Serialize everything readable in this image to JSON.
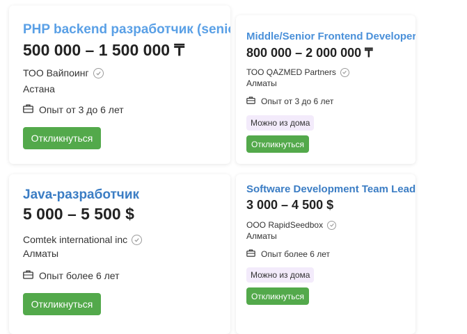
{
  "vacancies": [
    {
      "title": "PHP backend разработчик (senior)",
      "salary": "500 000 – 1 500 000 ₸",
      "company": "ТОО Вайпоинг",
      "city": "Астана",
      "experience": "Опыт от 3 до 6 лет",
      "remote": "",
      "apply_label": "Откликнуться"
    },
    {
      "title": "Middle/Senior Frontend Developer",
      "salary": "800 000 – 2 000 000 ₸",
      "company": "ТОО QAZMED Partners",
      "city": "Алматы",
      "experience": "Опыт от 3 до 6 лет",
      "remote": "Можно из дома",
      "apply_label": "Откликнуться"
    },
    {
      "title": "Java-разработчик",
      "salary": "5 000 – 5 500 $",
      "company": "Comtek international inc",
      "city": "Алматы",
      "experience": "Опыт более 6 лет",
      "remote": "",
      "apply_label": "Откликнуться"
    },
    {
      "title": "Software Development Team Lead",
      "salary": "3 000 – 4 500 $",
      "company": "ООО RapidSeedbox",
      "city": "Алматы",
      "experience": "Опыт более 6 лет",
      "remote": "Можно из дома",
      "apply_label": "Откликнуться"
    }
  ],
  "colors": {
    "title_first": "#5aa0e6",
    "title": "#3b7dc4",
    "button": "#53a94b",
    "badge_bg": "#f3ebfb"
  },
  "icons": {
    "verified": "check-circle-icon",
    "experience": "briefcase-icon"
  }
}
